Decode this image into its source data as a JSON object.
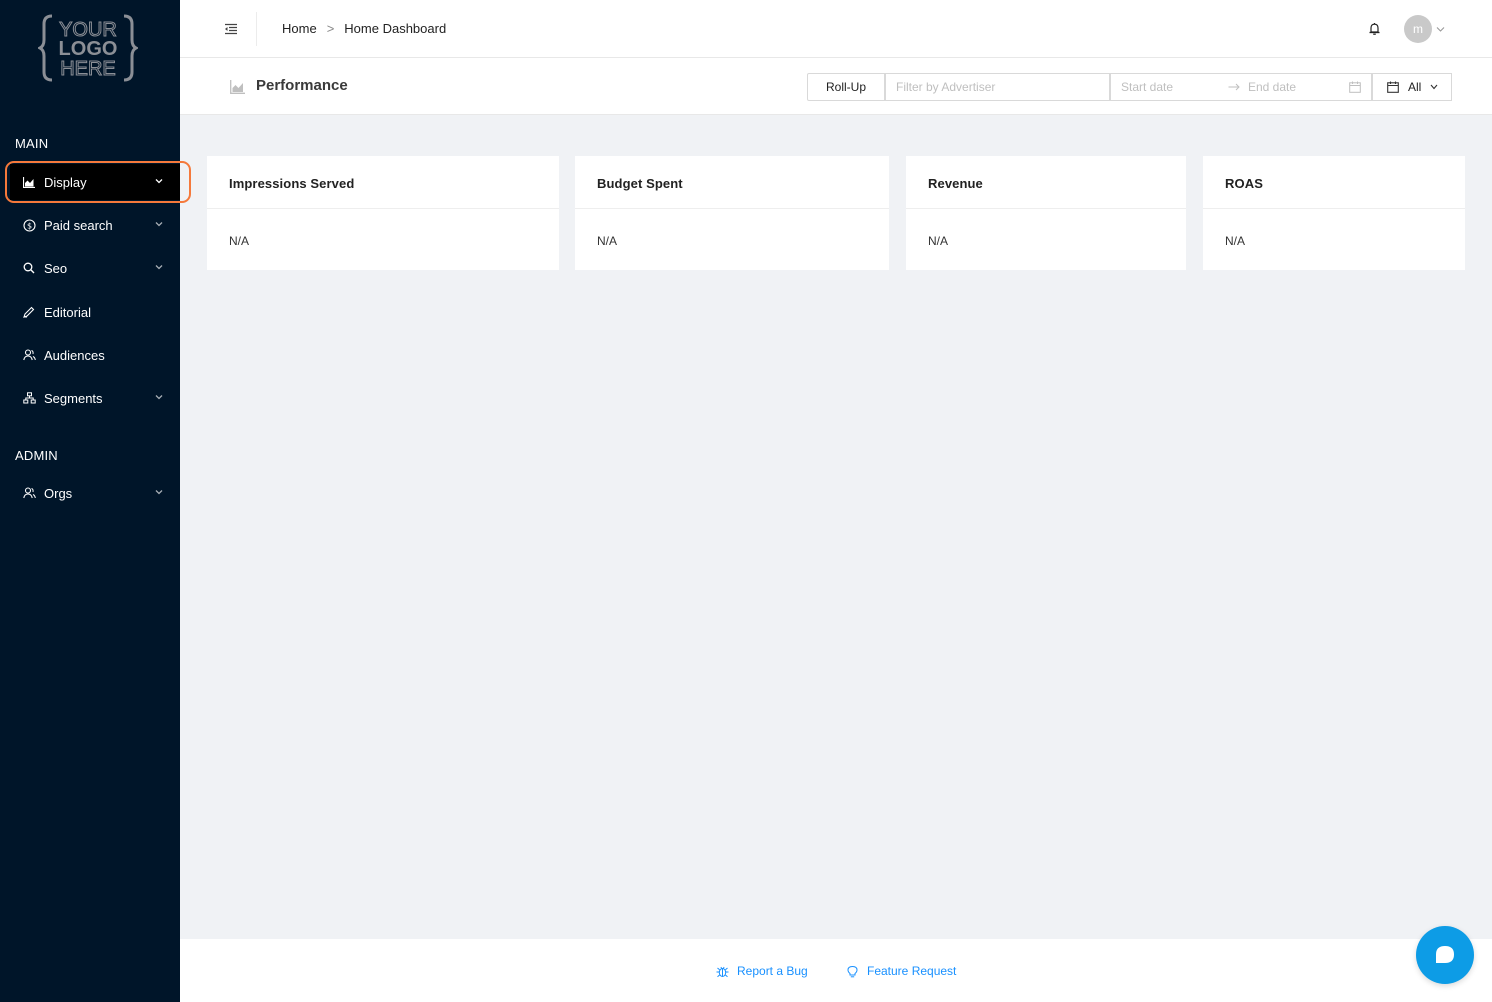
{
  "logo": {
    "line1": "YOUR",
    "line2": "LOGO",
    "line3": "HERE"
  },
  "sidebar": {
    "sections": [
      {
        "label": "MAIN"
      },
      {
        "label": "ADMIN"
      }
    ],
    "items": [
      {
        "label": "Display",
        "icon": "area-chart-icon",
        "expandable": true,
        "active": true
      },
      {
        "label": "Paid search",
        "icon": "dollar-circle-icon",
        "expandable": true
      },
      {
        "label": "Seo",
        "icon": "search-icon",
        "expandable": true
      },
      {
        "label": "Editorial",
        "icon": "pen-icon",
        "expandable": false
      },
      {
        "label": "Audiences",
        "icon": "user-group-icon",
        "expandable": false
      },
      {
        "label": "Segments",
        "icon": "cluster-icon",
        "expandable": true
      },
      {
        "label": "Orgs",
        "icon": "user-group-icon",
        "expandable": true
      }
    ]
  },
  "header": {
    "breadcrumb": {
      "home": "Home",
      "separator": ">",
      "current": "Home Dashboard"
    },
    "avatar_initial": "m"
  },
  "toolbar": {
    "title": "Performance",
    "rollup_label": "Roll-Up",
    "advertiser_placeholder": "Filter by Advertiser",
    "start_placeholder": "Start date",
    "end_placeholder": "End date",
    "period_label": "All"
  },
  "cards": [
    {
      "title": "Impressions Served",
      "value": "N/A"
    },
    {
      "title": "Budget Spent",
      "value": "N/A"
    },
    {
      "title": "Revenue",
      "value": "N/A"
    },
    {
      "title": "ROAS",
      "value": "N/A"
    }
  ],
  "footer": {
    "report_bug": "Report a Bug",
    "feature_request": "Feature Request"
  },
  "colors": {
    "sidebar_bg": "#001529",
    "active_item_bg": "#000000",
    "highlight": "#f5793b",
    "link": "#1890ff",
    "chat": "#0d9ce6"
  }
}
